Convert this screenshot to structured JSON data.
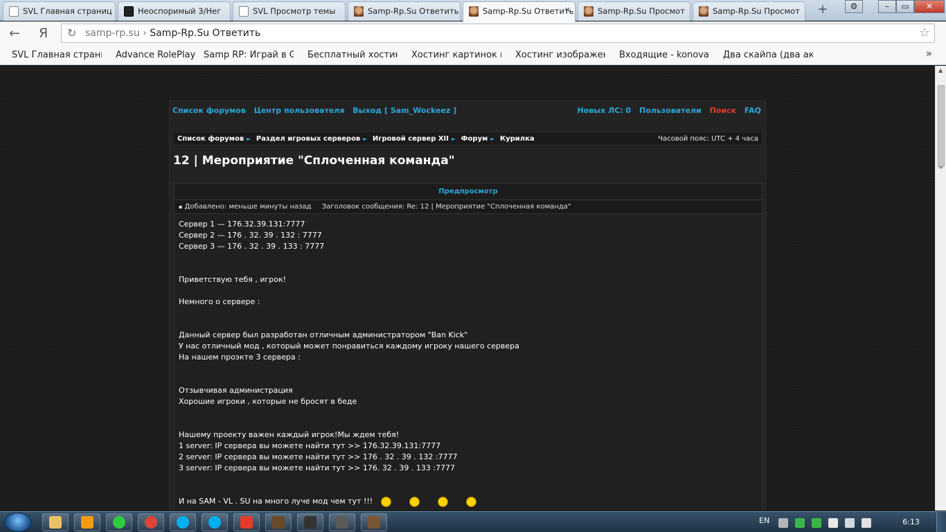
{
  "browser": {
    "tabs": [
      {
        "title": "SVL Главная страниц",
        "icon": "page-icon"
      },
      {
        "title": "Неоспоримый 3/Нег",
        "icon": "film-icon"
      },
      {
        "title": "SVL Просмотр темы",
        "icon": "page-icon"
      },
      {
        "title": "Samp-Rp.Su Ответить",
        "icon": "samp-icon"
      },
      {
        "title": "Samp-Rp.Su Ответить",
        "icon": "samp-icon",
        "active": true
      },
      {
        "title": "Samp-Rp.Su Просмот",
        "icon": "samp-icon"
      },
      {
        "title": "Samp-Rp.Su Просмот",
        "icon": "samp-icon"
      }
    ],
    "new_tab": "+",
    "window_buttons": {
      "settings": "⚙",
      "minimize": "–",
      "maximize": "▭",
      "close": "✕"
    },
    "nav": {
      "back": "←",
      "yandex": "Я",
      "refresh": "↻",
      "star": "☆"
    },
    "address": {
      "domain": "samp-rp.su",
      "separator": " › ",
      "title": "Samp-Rp.Su Ответить"
    },
    "bookmarks": [
      "SVL Главная страниц",
      "Advance RolePlay",
      "Samp RP: Играй в Gt",
      "Бесплатный хостинг",
      "Хостинг картинок и",
      "Хостинг изображени",
      "Входящие - konovalo",
      "Два скайпа (два акка"
    ],
    "bookmarks_more": "»"
  },
  "forum": {
    "topnav_left": [
      "Список форумов",
      "Центр пользователя",
      "Выход [ Sam_Wockeez ]"
    ],
    "topnav_right": [
      {
        "label": "Новых ЛС: 0",
        "color": "#2aa7d8"
      },
      {
        "label": "Пользователи",
        "color": "#2aa7d8"
      },
      {
        "label": "Поиск",
        "color": "#e53b2a"
      },
      {
        "label": "FAQ",
        "color": "#2aa7d8"
      }
    ],
    "breadcrumbs": [
      "Список форумов",
      "Раздел игровых серверов",
      "Игровой сервер XII",
      "Форум",
      "Курилка"
    ],
    "timezone": "Часовой пояс: UTC + 4 часа",
    "topic_title": "12 | Мероприятие \"Сплоченная команда\"",
    "preview": {
      "header": "Предпросмотр",
      "added": "Добавлено: меньше минуты назад",
      "subject": "Заголовок сообщения: Re: 12 | Мероприятие \"Сплоченная команда\"",
      "lines": [
        "Сервер 1 — 176.32.39.131:7777",
        "Сервер 2 — 176 . 32. 39 . 132 : 7777",
        "Сервер 3 — 176 . 32 . 39 . 133 : 7777",
        "",
        "",
        "Приветствую тебя , игрок!",
        "",
        "Немного о сервере :",
        "",
        "",
        "Данный сервер был разработан отличным администратором \"Ban Kick\"",
        "У нас отличный мод , который может понравиться каждому игроку нашего сервера",
        "На нашем проэкте 3 сервера :",
        "",
        "",
        "Отзывчивая администрация",
        "Хорошие игроки , которые не бросят в беде",
        "",
        "",
        "Нашему проекту важен каждый игрок!Мы ждем тебя!",
        "1 server: IP сервера вы можете найти тут >> 176.32.39.131:7777",
        "2 server: IP сервера вы можете найти тут >> 176 . 32 . 39 . 132 :7777",
        "3 server: IP сервера вы можете найти тут >> 176. 32 . 39 . 133 :7777",
        "",
        "",
        "И на SAM - VL . SU на много луче мод чем тут !!!"
      ]
    }
  },
  "taskbar": {
    "apps": [
      "explorer-icon",
      "media-player-icon",
      "utorrent-icon",
      "chrome-icon",
      "skype-icon",
      "skype-icon",
      "yandex-browser-icon",
      "game-icon",
      "counter-icon",
      "world-of-tanks-icon",
      "gta-icon"
    ],
    "language": "EN",
    "clock": "6:13"
  }
}
